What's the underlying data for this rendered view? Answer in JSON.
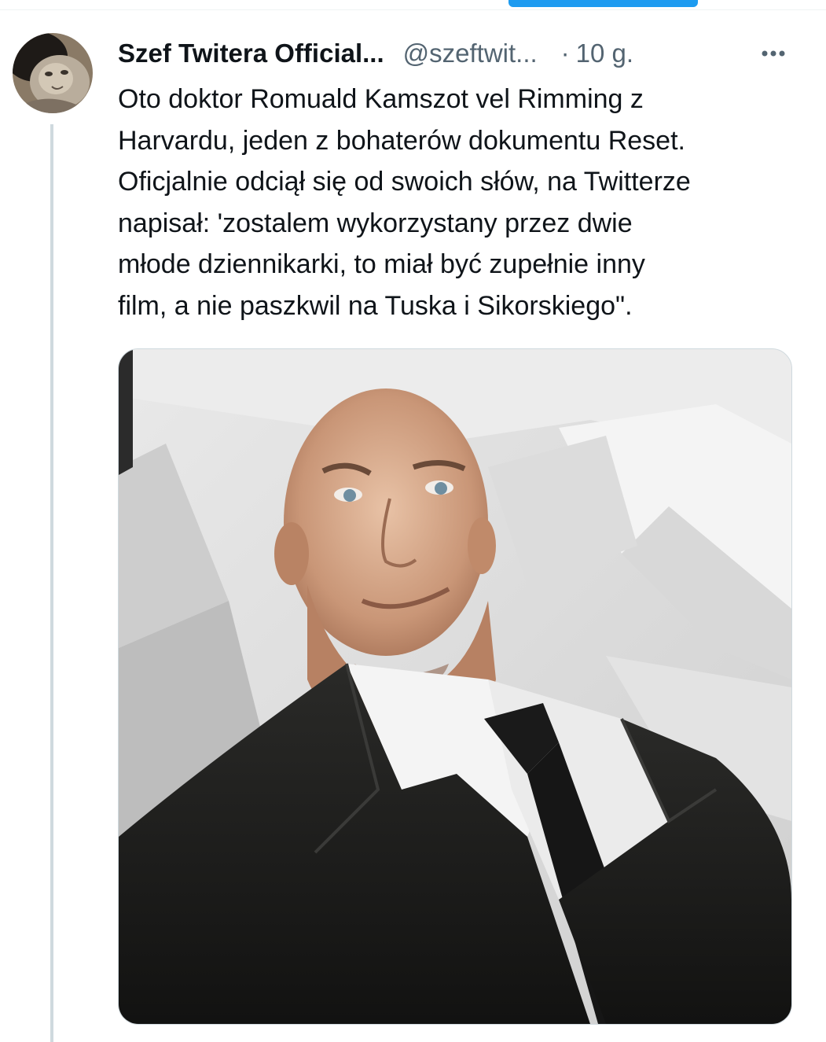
{
  "tweet": {
    "display_name": "Szef Twitera Official...",
    "handle": "@szeftwit...",
    "separator": "·",
    "time": "10 g.",
    "more_icon": "more-horizontal-icon",
    "text": "Oto doktor Romuald Kamszot vel Rimming z\nHarvardu, jeden z bohaterów dokumentu Reset.\nOficjalnie odciął się od swoich słów, na Twitterze\nnapisał: 'zostalem wykorzystany przez dwie\nmłode dziennikarki, to miał być zupełnie inny\nfilm, a nie paszkwil na Tuska i Sikorskiego\"."
  },
  "colors": {
    "accent": "#1d9bf0",
    "text_primary": "#0f1419",
    "text_secondary": "#536471",
    "border": "#cfd9de"
  }
}
